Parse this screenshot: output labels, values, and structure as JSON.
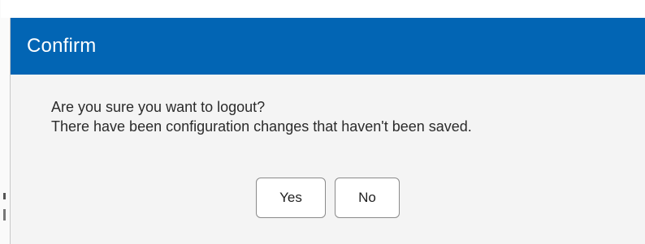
{
  "dialog": {
    "title": "Confirm",
    "message_line1": "Are you sure you want to logout?",
    "message_line2": "There have been configuration changes that haven't been saved.",
    "yes_label": "Yes",
    "no_label": "No"
  },
  "colors": {
    "header_background": "#0265b4",
    "header_text": "#ffffff",
    "dialog_background": "#f4f4f4",
    "button_border": "#8a8a8a"
  }
}
